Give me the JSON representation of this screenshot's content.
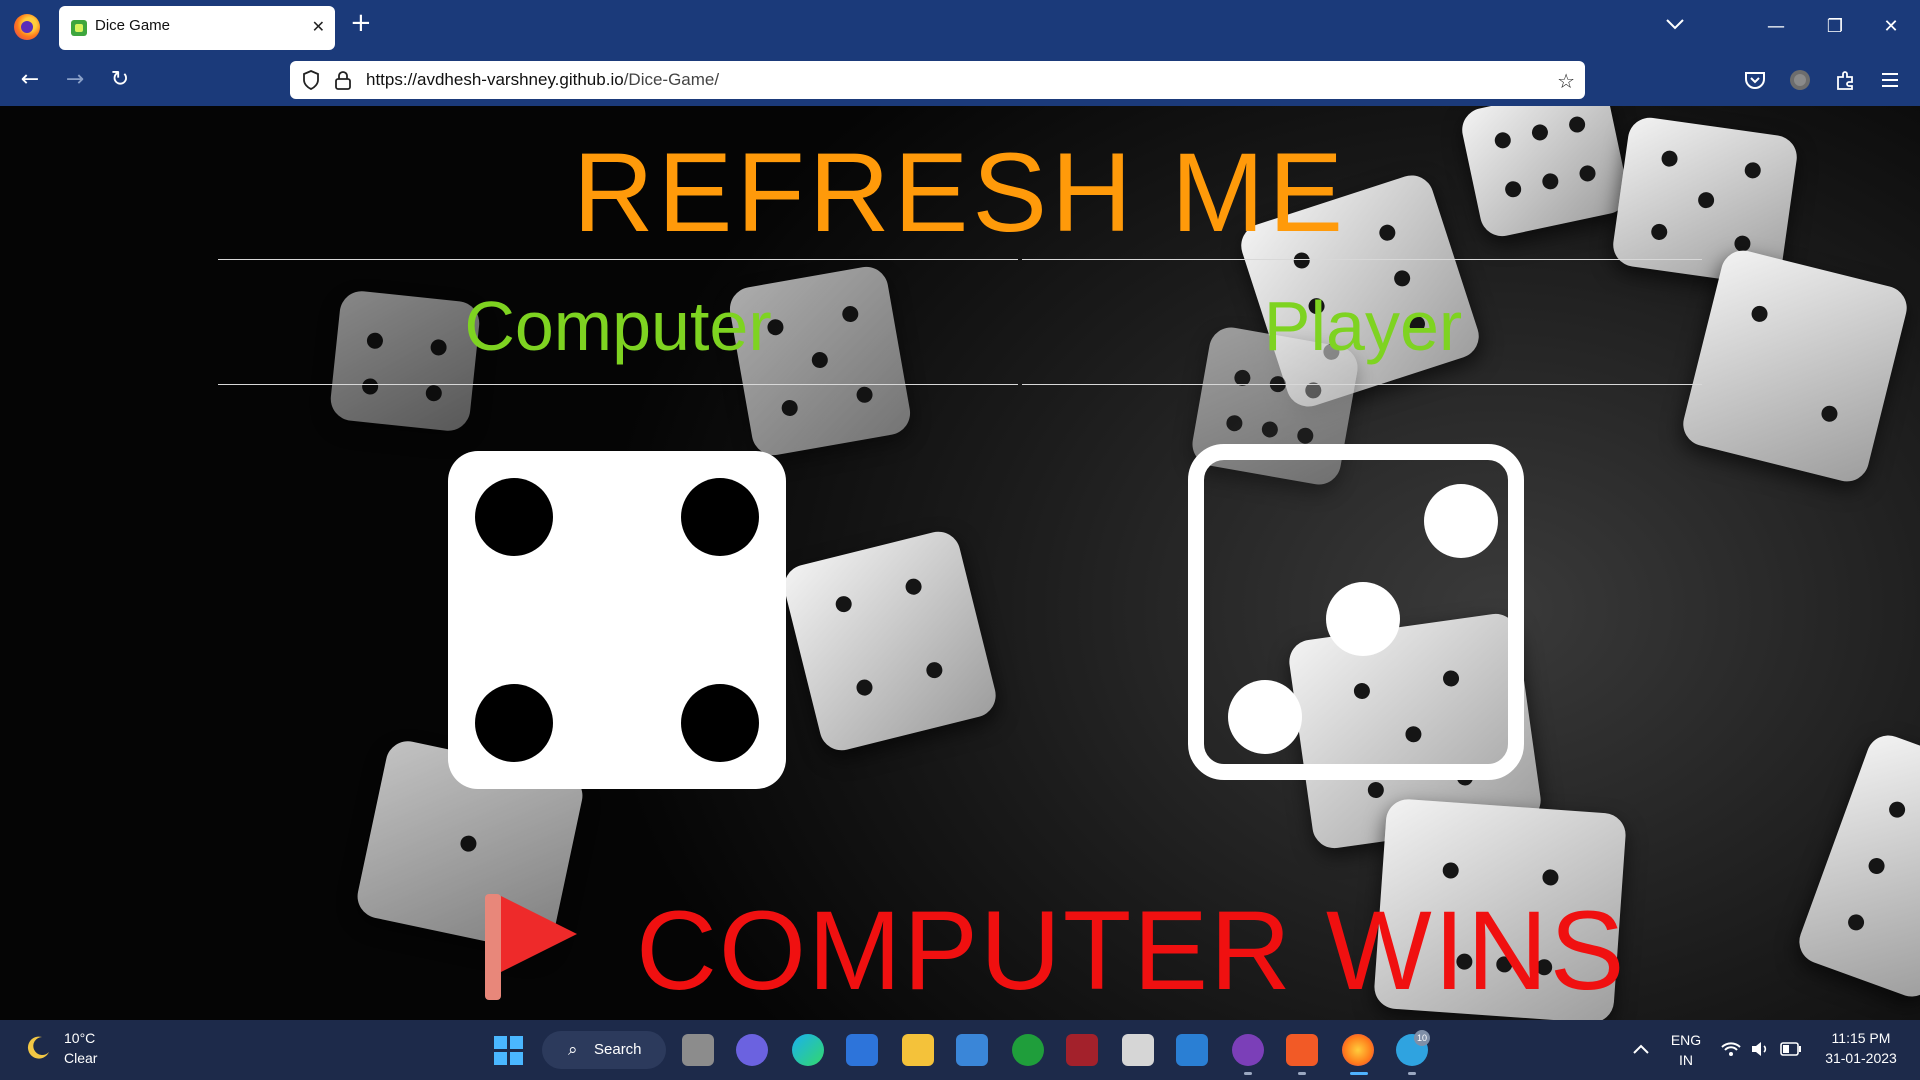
{
  "browser": {
    "tab_title": "Dice Game",
    "tab_close": "✕",
    "new_tab": "+",
    "url_host": "https://avdhesh-varshney.github.io",
    "url_path": "/Dice-Game/",
    "window_buttons": {
      "minimize": "—",
      "restore": "❐",
      "close": "✕"
    },
    "nav": {
      "back": "←",
      "forward": "→",
      "reload": "↻"
    }
  },
  "game": {
    "title": "REFRESH ME",
    "computer_label": "Computer",
    "player_label": "Player",
    "computer_value": 4,
    "player_value": 3,
    "result": "COMPUTER WINS"
  },
  "taskbar": {
    "weather_temp": "10°C",
    "weather_desc": "Clear",
    "search_label": "Search",
    "telegram_badge": "10",
    "language_top": "ENG",
    "language_bottom": "IN",
    "time": "11:15 PM",
    "date": "31-01-2023"
  },
  "colors": {
    "title": "#ff9a0a",
    "labels": "#7ed321",
    "result": "#f01010",
    "chrome": "#1b3a7a",
    "taskbar": "#1d2a4a"
  }
}
